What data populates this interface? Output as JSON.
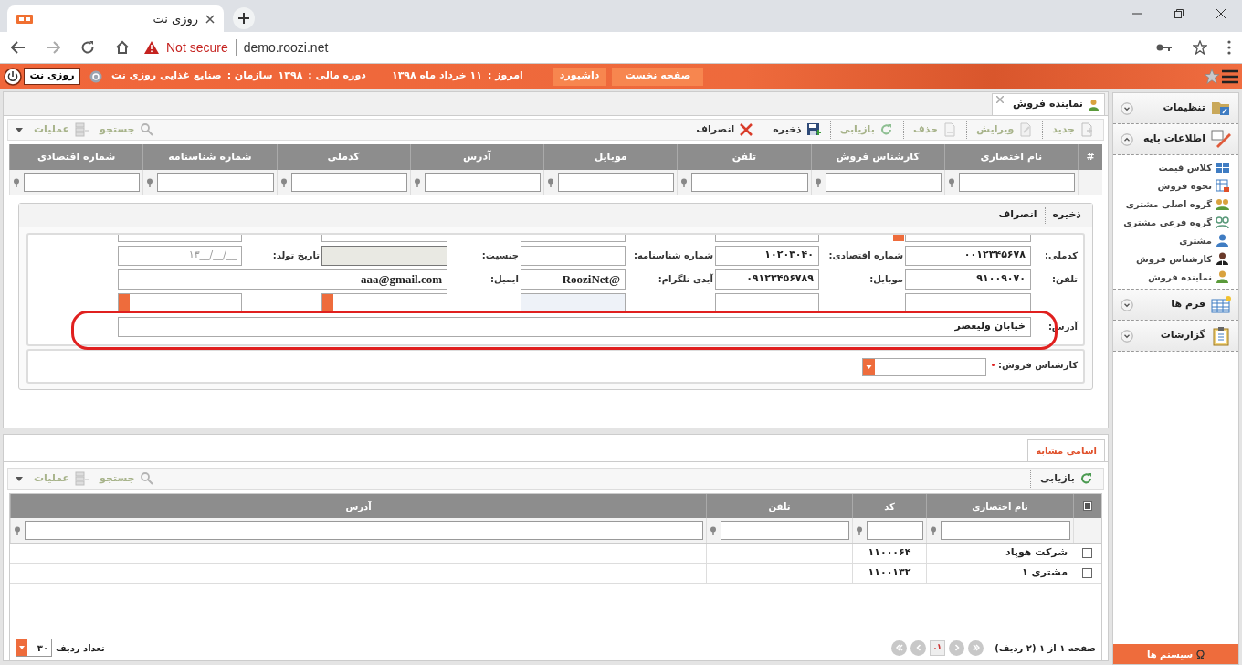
{
  "browser": {
    "tab_title": "روزی نت",
    "security": "Not secure",
    "url": "demo.roozi.net"
  },
  "header": {
    "user": "روزی نت",
    "organization_label": "سازمان :",
    "organization": "صنایع غذایی روزی نت",
    "fiscal_year_label": "دوره مالی :",
    "fiscal_year": "۱۳۹۸",
    "today_label": "امروز :",
    "today": "۱۱ خرداد ماه ۱۳۹۸",
    "buttons": [
      "صفحه نخست",
      "داشبورد"
    ]
  },
  "document_tab": {
    "title": "نماینده فروش"
  },
  "toolbar": {
    "actions": [
      {
        "label": "جدید",
        "kind": "new",
        "disabled": true
      },
      {
        "label": "ویرایش",
        "kind": "edit",
        "disabled": true
      },
      {
        "label": "حذف",
        "kind": "delete",
        "disabled": true
      },
      {
        "label": "بازیابی",
        "kind": "refresh",
        "disabled": true
      },
      {
        "label": "ذخیره",
        "kind": "save",
        "disabled": false
      },
      {
        "label": "انصراف",
        "kind": "cancel",
        "disabled": false
      }
    ],
    "tools": [
      {
        "label": "جستجو",
        "kind": "search",
        "disabled": true
      },
      {
        "label": "عملیات",
        "kind": "operations",
        "disabled": true
      }
    ]
  },
  "grid": {
    "columns": [
      "#",
      "نام اختصاری",
      "کارشناس فروش",
      "تلفن",
      "موبایل",
      "آدرس",
      "کدملی",
      "شماره شناسنامه",
      "شماره اقتصادی"
    ]
  },
  "form": {
    "actions": [
      "ذخیره",
      "انصراف"
    ],
    "rows": [
      {
        "fields": [
          {
            "label": "کدملی:",
            "value": "۰۰۱۲۳۴۵۶۷۸",
            "kind": "persian"
          },
          {
            "label": "شماره اقتصادی:",
            "value": "۱۰۲۰۳۰۴۰",
            "kind": "persian"
          },
          {
            "label": "شماره شناسنامه:",
            "kind": "persian"
          },
          {
            "label": "جنسیت:",
            "disabled": true,
            "kind": "persian"
          },
          {
            "label": "تاریخ تولد:",
            "placeholder": "۱۳__/__/__",
            "kind": "persian"
          }
        ]
      },
      {
        "fields": [
          {
            "label": "تلفن:",
            "value": "۹۱۰۰۹۰۷۰",
            "kind": "persian"
          },
          {
            "label": "موبایل:",
            "value": "۰۹۱۲۳۴۵۶۷۸۹",
            "kind": "persian"
          },
          {
            "label": "آیدی تلگرام:",
            "value": "RooziNet@",
            "kind": "latin"
          },
          {
            "label": "ایمیل:",
            "value": "aaa@gmail.com",
            "kind": "latin"
          }
        ]
      },
      {
        "kind": "obscured"
      },
      {
        "fields": [
          {
            "label": "آدرس:",
            "value": "خیابان ولیعصر",
            "kind": "persian"
          }
        ]
      }
    ],
    "sales_expert": {
      "label": "کارشناس فروش:",
      "required": true
    }
  },
  "similar": {
    "tab": {
      "title": "اسامی مشابه",
      "selected": true
    },
    "actions": [
      {
        "label": "بازیابی",
        "kind": "refresh",
        "disabled": false
      }
    ],
    "tools": [
      {
        "label": "جستجو",
        "kind": "search",
        "disabled": true
      },
      {
        "label": "عملیات",
        "kind": "operations",
        "disabled": true
      }
    ],
    "select_all": {
      "checked": false
    },
    "columns": [
      "نام اختصاری",
      "کد",
      "تلفن",
      "آدرس"
    ],
    "rows": [
      {
        "name": "شرکت هوپاد",
        "code": "۱۱۰۰۰۶۴",
        "checked": false
      },
      {
        "name": "مشتری ۱",
        "code": "۱۱۰۰۱۳۲",
        "checked": false
      }
    ],
    "footer": {
      "page_info": "صفحه ۱ از ۱ (۲ ردیف)",
      "current_page": "۱.",
      "rows_label": "تعداد ردیف",
      "rows_per_page": "۳۰"
    }
  },
  "sidebar": {
    "sections": [
      {
        "title": "تنظیمات",
        "kind": "settings",
        "expanded": false
      },
      {
        "title": "اطلاعات پایه",
        "kind": "base",
        "expanded": true,
        "items": [
          {
            "label": "کلاس قیمت",
            "kind": "price"
          },
          {
            "label": "نحوه فروش",
            "kind": "sale"
          },
          {
            "label": "گروه اصلی مشتری",
            "kind": "group"
          },
          {
            "label": "گروه فرعی مشتری",
            "kind": "subgroup"
          },
          {
            "label": "مشتری",
            "kind": "customer"
          },
          {
            "label": "کارشناس فروش",
            "kind": "expert"
          },
          {
            "label": "نماینده فروش",
            "kind": "agent"
          }
        ]
      },
      {
        "title": "فرم ها",
        "kind": "forms",
        "expanded": false
      },
      {
        "title": "گزارشات",
        "kind": "reports",
        "expanded": false
      }
    ],
    "footer": "سیستم ها"
  }
}
